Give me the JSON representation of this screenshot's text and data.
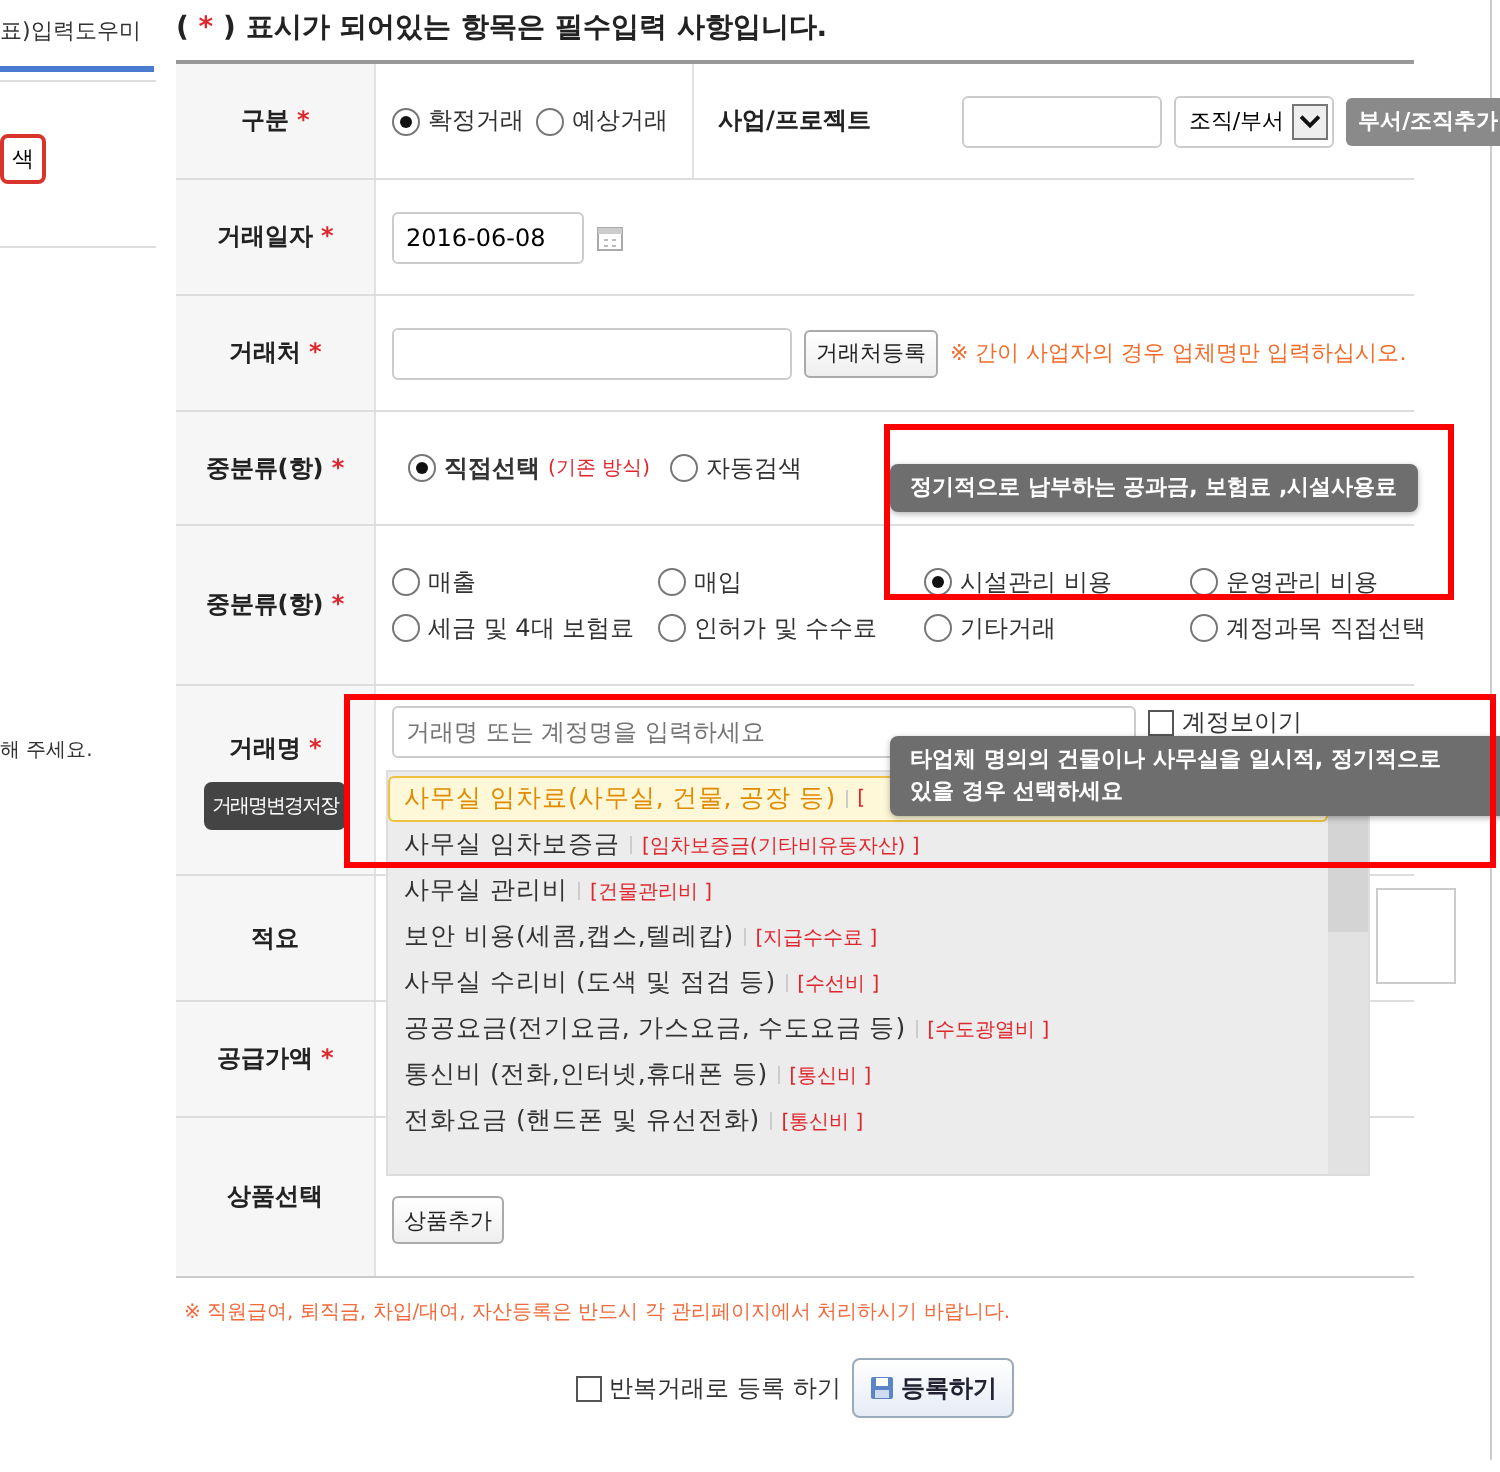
{
  "sidebar": {
    "tab": "표)입력도우미",
    "button": "색",
    "note": "해 주세요."
  },
  "notice": {
    "before": "( ",
    "star": "*",
    "after": " ) 표시가 되어있는 항목은 필수입력 사항입니다."
  },
  "rows": [
    {
      "kind": "type",
      "label": "구분",
      "required": true,
      "options": [
        {
          "label": "확정거래",
          "selected": true
        },
        {
          "label": "예상거래",
          "selected": false
        }
      ],
      "project_label": "사업/프로젝트",
      "org_select": "조직/부서",
      "org_button": "부서/조직추가"
    },
    {
      "kind": "date",
      "label": "거래일자",
      "required": true,
      "value": "2016-06-08"
    },
    {
      "kind": "partner",
      "label": "거래처",
      "required": true,
      "button": "거래처등록",
      "note": "※ 간이 사업자의 경우 업체명만 입력하십시오."
    },
    {
      "kind": "method",
      "label": "중분류(항)",
      "required": true,
      "options": [
        {
          "label": "직접선택",
          "hint": "(기존 방식)",
          "selected": true
        },
        {
          "label": "자동검색",
          "selected": false
        }
      ]
    },
    {
      "kind": "category",
      "label": "중분류(항)",
      "required": true,
      "options": [
        {
          "label": "매출",
          "selected": false
        },
        {
          "label": "매입",
          "selected": false
        },
        {
          "label": "시설관리 비용",
          "selected": true
        },
        {
          "label": "운영관리 비용",
          "selected": false
        },
        {
          "label": "세금 및 4대 보험료",
          "selected": false
        },
        {
          "label": "인허가 및 수수료",
          "selected": false
        },
        {
          "label": "기타거래",
          "selected": false
        },
        {
          "label": "계정과목 직접선택",
          "selected": false
        }
      ]
    },
    {
      "kind": "name",
      "label": "거래명",
      "required": true,
      "button": "거래명변경저장",
      "placeholder": "거래명 또는 계정명을 입력하세요",
      "checkbox": {
        "label": "계정보이기",
        "checked": false
      }
    },
    {
      "kind": "memo",
      "label": "적요",
      "required": false
    },
    {
      "kind": "amount",
      "label": "공급가액",
      "required": true
    },
    {
      "kind": "product",
      "label": "상품선택",
      "required": false,
      "button": "상품추가"
    }
  ],
  "footer_note": "※ 직원급여, 퇴직금, 차입/대여, 자산등록은 반드시 각 관리페이지에서 처리하시기 바랍니다.",
  "repeat": {
    "label": "반복거래로 등록 하기",
    "checked": false
  },
  "submit": "등록하기",
  "dropdown": [
    {
      "name": "사무실 임차료(사무실, 건물, 공장 등)",
      "account": "[",
      "selected": true
    },
    {
      "name": "사무실 임차보증금",
      "account": "[임차보증금(기타비유동자산) ]",
      "selected": false
    },
    {
      "name": "사무실 관리비",
      "account": "[건물관리비 ]",
      "selected": false
    },
    {
      "name": "보안 비용(세콤,캡스,텔레캅)",
      "account": "[지급수수료 ]",
      "selected": false
    },
    {
      "name": "사무실 수리비 (도색 및 점검 등)",
      "account": "[수선비 ]",
      "selected": false
    },
    {
      "name": "공공요금(전기요금, 가스요금, 수도요금 등)",
      "account": "[수도광열비 ]",
      "selected": false
    },
    {
      "name": "통신비 (전화,인터넷,휴대폰 등)",
      "account": "[통신비 ]",
      "selected": false
    },
    {
      "name": "전화요금 (핸드폰 및 유선전화)",
      "account": "[통신비 ]",
      "selected": false
    }
  ],
  "tooltips": [
    {
      "lines": [
        "정기적으로 납부하는 공과금, 보험료 ,시설사용료"
      ]
    },
    {
      "lines": [
        "타업체 명의의 건물이나 사무실을 일시적, 정기적으로",
        "있을 경우 선택하세요"
      ]
    }
  ]
}
